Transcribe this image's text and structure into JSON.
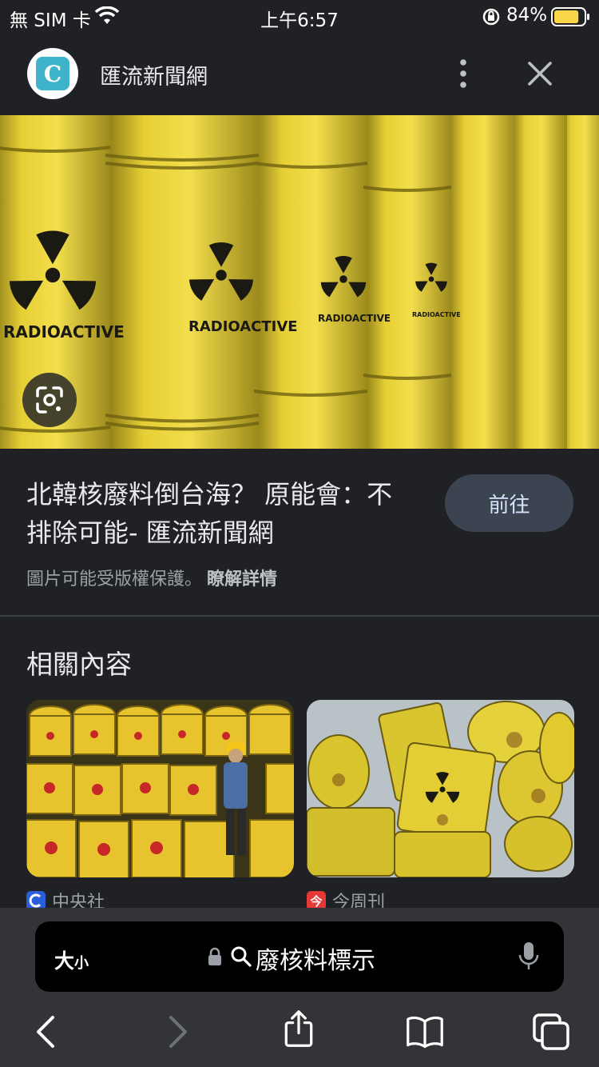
{
  "status": {
    "carrier": "無 SIM 卡",
    "time": "上午6:57",
    "battery": "84%",
    "battery_level": 0.84,
    "battery_color": "#f9d64a"
  },
  "header": {
    "site_name": "匯流新聞網",
    "logo_letter": "C",
    "icons": [
      "more-vert-icon",
      "close-icon"
    ]
  },
  "hero": {
    "labels": [
      "RADIOACTIVE",
      "RADIOACTIVE",
      "RADIOACTIVE",
      "RADIOACTIVE"
    ],
    "lens_icon": "google-lens-icon"
  },
  "result": {
    "title": "北韓核廢料倒台海？ 原能會：不排除可能- 匯流新聞網",
    "go_button": "前往",
    "copyright": "圖片可能受版權保護。",
    "learn_more": "瞭解詳情"
  },
  "related": {
    "heading": "相關內容",
    "items": [
      {
        "source": "中央社",
        "favicon_color": "#2b5fd9"
      },
      {
        "source": "今周刊",
        "favicon_color": "#e53935",
        "favicon_char": "今"
      }
    ]
  },
  "toolbar": {
    "text_size": "大",
    "text_size_small": "小",
    "query": "廢核料標示",
    "icons": [
      "back-icon",
      "forward-icon",
      "share-icon",
      "bookmarks-icon",
      "tabs-icon"
    ]
  }
}
